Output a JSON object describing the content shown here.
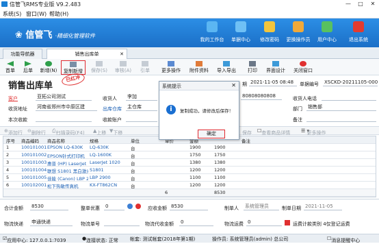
{
  "window": {
    "title": "信管飞RMS专业版 V9.2.483",
    "minimize": "—",
    "maximize": "□",
    "close": "✕"
  },
  "menu": {
    "system": "系统(S)",
    "window": "窗口(W)",
    "help": "帮助(H)"
  },
  "banner": {
    "logo": "信管飞",
    "slogan": "·精细化管理软件",
    "items": [
      {
        "label": "我的工作台",
        "icon": "desktop-icon",
        "color": "#5bb6f2"
      },
      {
        "label": "单据中心",
        "icon": "document-center-icon",
        "color": "#6fc0f5"
      },
      {
        "label": "修改密码",
        "icon": "key-icon",
        "color": "#f2c53d"
      },
      {
        "label": "更换操作员",
        "icon": "user-icon",
        "color": "#f0a93a"
      },
      {
        "label": "用户中心",
        "icon": "globe-icon",
        "color": "#58c160"
      },
      {
        "label": "退出系统",
        "icon": "power-icon",
        "color": "#e23b2f"
      }
    ]
  },
  "tabs": [
    {
      "label": "功能导航器",
      "active": false
    },
    {
      "label": "销售出库单",
      "active": true
    }
  ],
  "toolbar": {
    "first": "首单",
    "last": "后单",
    "new": "新增(N)",
    "copy_new": "复制新增",
    "save": "保存(S)",
    "audit": "审核(A)",
    "cite": "引单",
    "more": "更多操作",
    "attach": "附件资料",
    "import_export": "导入导出",
    "print": "打印",
    "ui_design": "界面设计",
    "close": "关闭窗口"
  },
  "doc": {
    "title": "销售出库单",
    "stamp": "已红冲",
    "customer_label": "客户",
    "customer": "亚拓公司测试",
    "receiver_label": "收货人",
    "receiver": "李加",
    "date_label": "期",
    "date": "2021-11-05 08:48",
    "docno_label": "单据编号",
    "docno": "XSCKD-20211105-0001",
    "ship_addr_label": "收货地址",
    "ship_addr": "河南省郑州市中原区建",
    "warehouse_label": "出库仓库",
    "warehouse": "主仓库",
    "phone_part": "80808080808",
    "receiver_phone_label": "收货人电话",
    "receipt_label": "本次收款",
    "account_label": "收款账户",
    "dept_label": "部门",
    "dept": "销售部",
    "note_label": "备注"
  },
  "subtools": {
    "add_row": "添加行",
    "del_row": "删除行",
    "scan": "扫描录码(F4)",
    "move_up": "上移",
    "move_down": "下移",
    "save_short": "保存",
    "view_detail": "查看商品详情",
    "more_ops": "更多操作"
  },
  "table": {
    "headers": [
      "序号",
      "商品编码",
      "商品名称",
      "规格",
      "单位",
      "单价",
      "金额",
      "备注"
    ],
    "rows": [
      [
        "1",
        "100101001",
        "EPSON LQ-630K",
        "LQ-630K",
        "台",
        "1900",
        "1900"
      ],
      [
        "2",
        "100101002",
        "EPSON针式打印机",
        "LQ-1600K",
        "台",
        "1750",
        "1750"
      ],
      [
        "3",
        "100101003",
        "惠普 (HP) LaserJet 1020",
        "LaserJet 1020",
        "台",
        "1380",
        "1380"
      ],
      [
        "4",
        "100101004",
        "联想 S1801 黑白激光打印",
        "S1801",
        "台",
        "1200",
        "1200"
      ],
      [
        "5",
        "100101005",
        "佳能 (Canon) LBP 2900+",
        "LBP 2900",
        "台",
        "1100",
        "1100"
      ],
      [
        "6",
        "100102001",
        "松下热敏传真机",
        "KX-FT862CN",
        "台",
        "1200",
        "1200"
      ]
    ],
    "qty_total": "6",
    "amount_total": "8530"
  },
  "footer": {
    "total_label": "合计金额",
    "total": "8530",
    "discount_label": "整单优惠",
    "discount": "0",
    "receivable_label": "应收金额",
    "receivable": "8530",
    "maker_label": "制单人",
    "maker": "系统管理员",
    "make_date_label": "制单日期",
    "make_date": "2021-11-05",
    "logistics_label": "物流快递",
    "logistics": "申通快递",
    "tracking_label": "物流单号",
    "logistics_fee_label": "物流代收金额",
    "logistics_fee": "0",
    "freight_label": "物流运费",
    "freight": "0",
    "freight_note": "运费计款类别 4仅登记运费"
  },
  "status": {
    "app_center": "应用中心: 127.0.0.1:7039",
    "conn": "连接状态: 正常",
    "account": "帐套: 测试帐套(2018年第1期)",
    "operator": "操作员: 系统管理员(admin) 总公司",
    "msg": "消息提醒中心"
  },
  "dialog": {
    "title": "系统提示",
    "message": "复制成功，请修改后保存！",
    "ok": "确定"
  },
  "colors": {
    "accent": "#1b6fc7",
    "highlight": "#e0282e"
  }
}
